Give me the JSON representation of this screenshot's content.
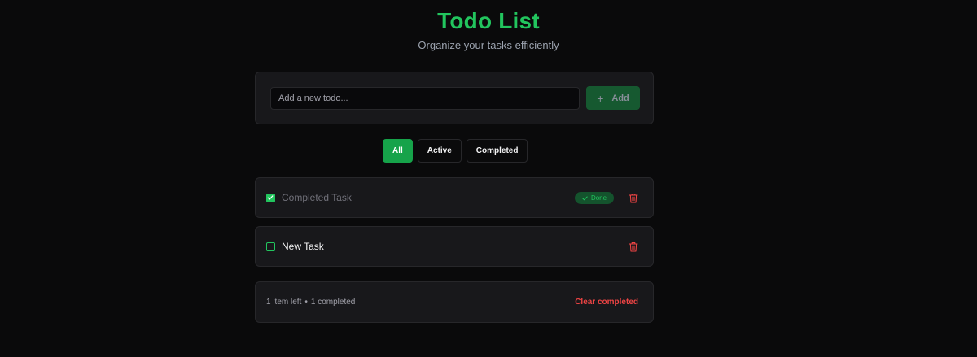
{
  "header": {
    "title": "Todo List",
    "subtitle": "Organize your tasks efficiently"
  },
  "add_form": {
    "placeholder": "Add a new todo...",
    "value": "",
    "button_label": "Add",
    "button_icon": "plus-icon"
  },
  "filters": {
    "all": "All",
    "active": "Active",
    "completed": "Completed",
    "selected": "All"
  },
  "todos": [
    {
      "text": "Completed Task",
      "completed": true,
      "badge": "Done"
    },
    {
      "text": "New Task",
      "completed": false
    }
  ],
  "footer": {
    "items_left": "1 item left",
    "separator": "•",
    "completed_count": "1 completed",
    "clear_label": "Clear completed"
  },
  "colors": {
    "accent": "#22c55e",
    "danger": "#ef4444",
    "background": "#0a0a0b",
    "card": "#18181b"
  }
}
